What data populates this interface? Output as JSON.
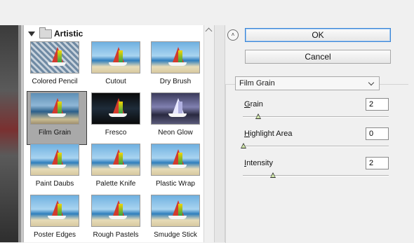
{
  "gallery": {
    "category": "Artistic",
    "filters": [
      {
        "label": "Colored Pencil",
        "style": "pencil"
      },
      {
        "label": "Cutout",
        "style": "normal"
      },
      {
        "label": "Dry Brush",
        "style": "normal"
      },
      {
        "label": "Film Grain",
        "style": "film",
        "selected": true
      },
      {
        "label": "Fresco",
        "style": "dark"
      },
      {
        "label": "Neon Glow",
        "style": "neon"
      },
      {
        "label": "Paint Daubs",
        "style": "normal"
      },
      {
        "label": "Palette Knife",
        "style": "normal"
      },
      {
        "label": "Plastic Wrap",
        "style": "normal"
      },
      {
        "label": "Poster Edges",
        "style": "normal"
      },
      {
        "label": "Rough Pastels",
        "style": "normal"
      },
      {
        "label": "Smudge Stick",
        "style": "normal"
      }
    ]
  },
  "actions": {
    "ok_label": "OK",
    "cancel_label": "Cancel"
  },
  "settings": {
    "filter_selected": "Film Grain",
    "params": [
      {
        "label": "Grain",
        "accel": "G",
        "rest": "rain",
        "value": "2",
        "fraction": 0.1
      },
      {
        "label": "Highlight Area",
        "accel": "H",
        "rest": "ighlight Area",
        "value": "0",
        "fraction": 0.0
      },
      {
        "label": "Intensity",
        "accel": "I",
        "rest": "ntensity",
        "value": "2",
        "fraction": 0.2
      }
    ]
  },
  "colors": {
    "ok_border": "#3a85d6",
    "selected_thumb_bg": "#a9a9a9"
  }
}
